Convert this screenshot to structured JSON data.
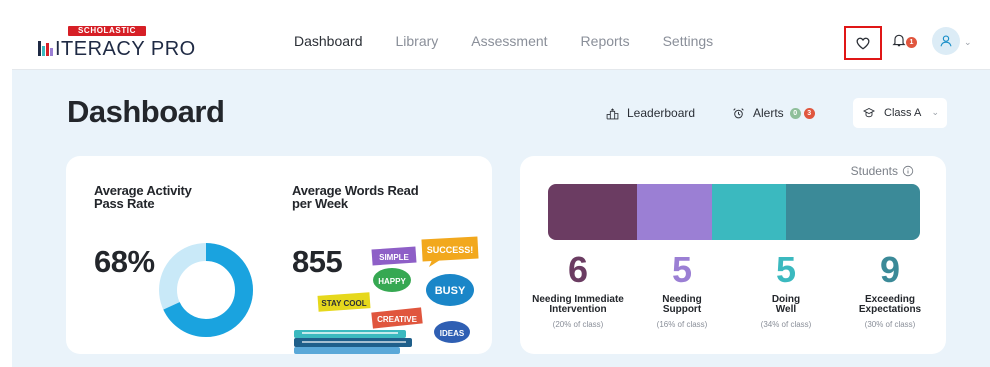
{
  "brand": {
    "top": "SCHOLASTIC",
    "main_suffix": "ITERACY PRO",
    "colors": {
      "red": "#d61f26",
      "navy": "#1f2a44"
    }
  },
  "nav": {
    "items": [
      {
        "label": "Dashboard",
        "active": true
      },
      {
        "label": "Library",
        "active": false
      },
      {
        "label": "Assessment",
        "active": false
      },
      {
        "label": "Reports",
        "active": false
      },
      {
        "label": "Settings",
        "active": false
      }
    ]
  },
  "top_icons": {
    "favorites": "heart-icon",
    "notifications": "bell-icon",
    "notifications_count": "1",
    "profile": "user-icon"
  },
  "page": {
    "title": "Dashboard"
  },
  "toolbar": {
    "leaderboard_label": "Leaderboard",
    "alerts_label": "Alerts",
    "alerts_badge_green": "0",
    "alerts_badge_red": "3",
    "class_select": "Class A"
  },
  "activity": {
    "title_line1": "Average Activity",
    "title_line2": "Pass Rate",
    "value": "68%",
    "rate": 0.68,
    "colors": {
      "fill": "#1aa3df",
      "track": "#c9e9f8"
    }
  },
  "words": {
    "title_line1": "Average Words Read",
    "title_line2": "per Week",
    "value": "855",
    "stickers": [
      "SIMPLE",
      "SUCCESS!",
      "HAPPY",
      "BUSY",
      "STAY COOL",
      "CREATIVE",
      "IDEAS"
    ]
  },
  "students": {
    "label": "Students",
    "groups": [
      {
        "count": "6",
        "count_num": 6,
        "line1": "Needing Immediate",
        "line2": "Intervention",
        "pct": "(20% of class)",
        "color": "#6b3c62"
      },
      {
        "count": "5",
        "count_num": 5,
        "line1": "Needing",
        "line2": "Support",
        "pct": "(16% of class)",
        "color": "#9b7fd4"
      },
      {
        "count": "5",
        "count_num": 5,
        "line1": "Doing",
        "line2": "Well",
        "pct": "(34% of class)",
        "color": "#3bb9bf"
      },
      {
        "count": "9",
        "count_num": 9,
        "line1": "Exceeding",
        "line2": "Expectations",
        "pct": "(30% of class)",
        "color": "#3b8a98"
      }
    ]
  }
}
